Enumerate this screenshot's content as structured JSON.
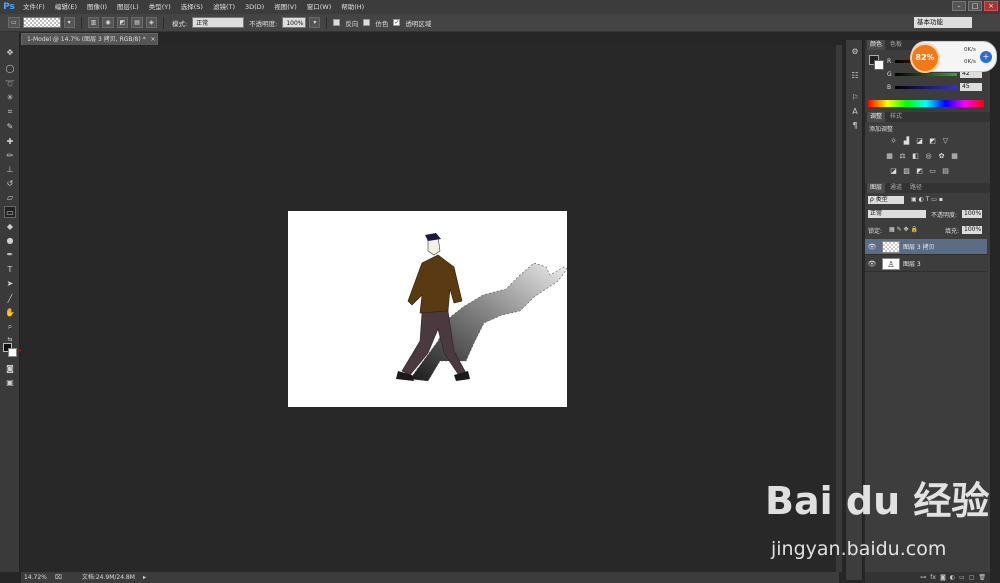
{
  "app": {
    "logo": "Ps"
  },
  "menu": [
    "文件(F)",
    "编辑(E)",
    "图像(I)",
    "图层(L)",
    "类型(Y)",
    "选择(S)",
    "滤镜(T)",
    "3D(D)",
    "视图(V)",
    "窗口(W)",
    "帮助(H)"
  ],
  "window_controls": [
    "–",
    "□",
    "×"
  ],
  "options": {
    "mode_label": "模式:",
    "mode_value": "正常",
    "opacity_label": "不透明度:",
    "opacity_value": "100%",
    "reverse_label": "反向",
    "dither_label": "仿色",
    "transparency_label": "透明区域",
    "workspace": "基本功能"
  },
  "document": {
    "tab_title": "1-Model @ 14.7% (图层 3 拷贝, RGB/8) *",
    "tab_close": "×"
  },
  "status": {
    "zoom": "14.72%",
    "doc_size": "文档:24.9M/24.8M"
  },
  "color_panel": {
    "tabs": [
      "颜色",
      "色板"
    ],
    "channels": [
      {
        "label": "R",
        "value": "0"
      },
      {
        "label": "G",
        "value": "42"
      },
      {
        "label": "B",
        "value": "45"
      }
    ],
    "colors": {
      "r_track": "#c33",
      "g_track": "#3a3",
      "b_track": "#33c"
    }
  },
  "speed_widget": {
    "percent": "82%",
    "up": "0K/s",
    "down": "0K/s",
    "plus": "+"
  },
  "adjust_panel": {
    "tabs": [
      "调整",
      "样式"
    ],
    "title": "添加调整"
  },
  "layers_panel": {
    "tabs": [
      "图层",
      "通道",
      "路径"
    ],
    "filter": "ρ 类型",
    "blend_mode": "正常",
    "opacity_label": "不透明度:",
    "opacity_value": "100%",
    "lock_label": "锁定:",
    "fill_label": "填充:",
    "fill_value": "100%",
    "layers": [
      {
        "name": "图层 3 拷贝",
        "selected": true
      },
      {
        "name": "图层 3",
        "selected": false
      }
    ]
  },
  "watermark": {
    "logo": "Bai du 经验",
    "url": "jingyan.baidu.com"
  },
  "colors": {
    "annotation_arrow": "#cc1111",
    "selection": "#5b6c85"
  }
}
